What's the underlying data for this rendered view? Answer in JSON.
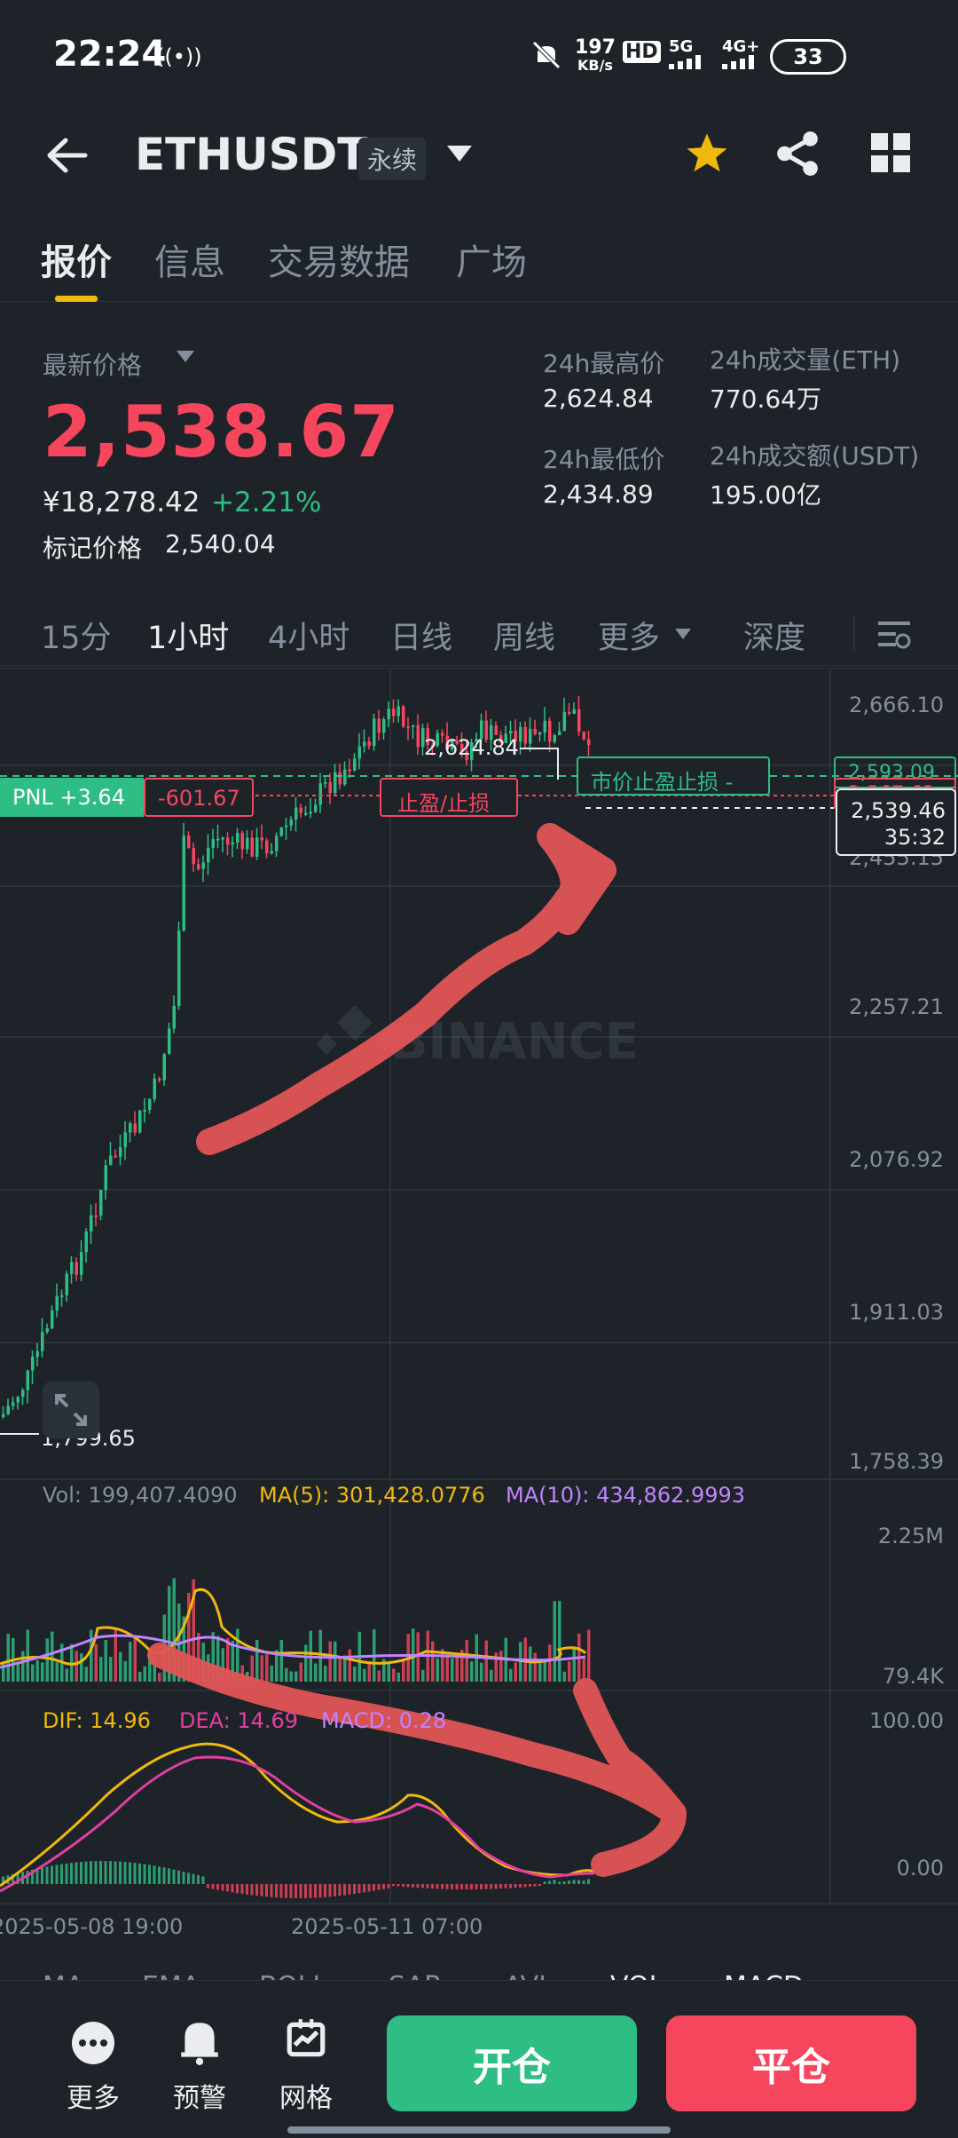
{
  "status": {
    "time": "22:24",
    "net_speed": "197",
    "net_unit": "KB/s",
    "hd": "HD",
    "g5": "5G",
    "g4": "4G+",
    "battery": "33"
  },
  "header": {
    "symbol": "ETHUSDT",
    "contract_type": "永续"
  },
  "tabs": [
    "报价",
    "信息",
    "交易数据",
    "广场"
  ],
  "ticker": {
    "last_price_label": "最新价格",
    "last_price": "2,538.67",
    "cny_price": "¥18,278.42",
    "change_pct": "+2.21%",
    "mark_label": "标记价格",
    "mark_price": "2,540.04",
    "high_label": "24h最高价",
    "high": "2,624.84",
    "low_label": "24h最低价",
    "low": "2,434.89",
    "vol_eth_label": "24h成交量(ETH)",
    "vol_eth": "770.64万",
    "vol_usdt_label": "24h成交额(USDT)",
    "vol_usdt": "195.00亿"
  },
  "intervals": [
    "15分",
    "1小时",
    "4小时",
    "日线",
    "周线",
    "更多",
    "深度"
  ],
  "chart": {
    "y_ticks": [
      "2,666.10",
      "2,257.21",
      "2,076.92",
      "1,911.03",
      "1,758.39"
    ],
    "partial_tick": "2,455.15",
    "partial_tick2": "2,593.09",
    "partial_tick3": "2,567.62",
    "max_label": "2,624.84",
    "min_label": "1,799.65",
    "pnl": "PNL +3.64",
    "pnl_loss": "-601.67",
    "tp_sl": "止盈/止损",
    "market_tp_sl": "市价止盈止损 -",
    "current_price": "2,539.46",
    "countdown": "35:32",
    "watermark": "BINANCE",
    "colors": {
      "up": "#2ebd85",
      "down": "#f6465d",
      "accent": "#f0b90b"
    }
  },
  "volume": {
    "vol_label": "Vol: 199,407.4090",
    "ma5_label": "MA(5): 301,428.0776",
    "ma10_label": "MA(10): 434,862.9993",
    "y_top": "2.25M",
    "y_bottom": "79.4K"
  },
  "macd": {
    "dif_label": "DIF: 14.96",
    "dea_label": "DEA: 14.69",
    "macd_label": "MACD: 0.28",
    "y_top": "100.00",
    "y_bottom": "0.00"
  },
  "time_axis": [
    "2025-05-08 19:00",
    "2025-05-11 07:00"
  ],
  "indicator_tabs": [
    "MA",
    "EMA",
    "BOLL",
    "SAR",
    "AVL",
    "VOL",
    "MACD"
  ],
  "bottom": {
    "more": "更多",
    "alert": "预警",
    "grid": "网格",
    "open": "开仓",
    "close": "平仓"
  }
}
